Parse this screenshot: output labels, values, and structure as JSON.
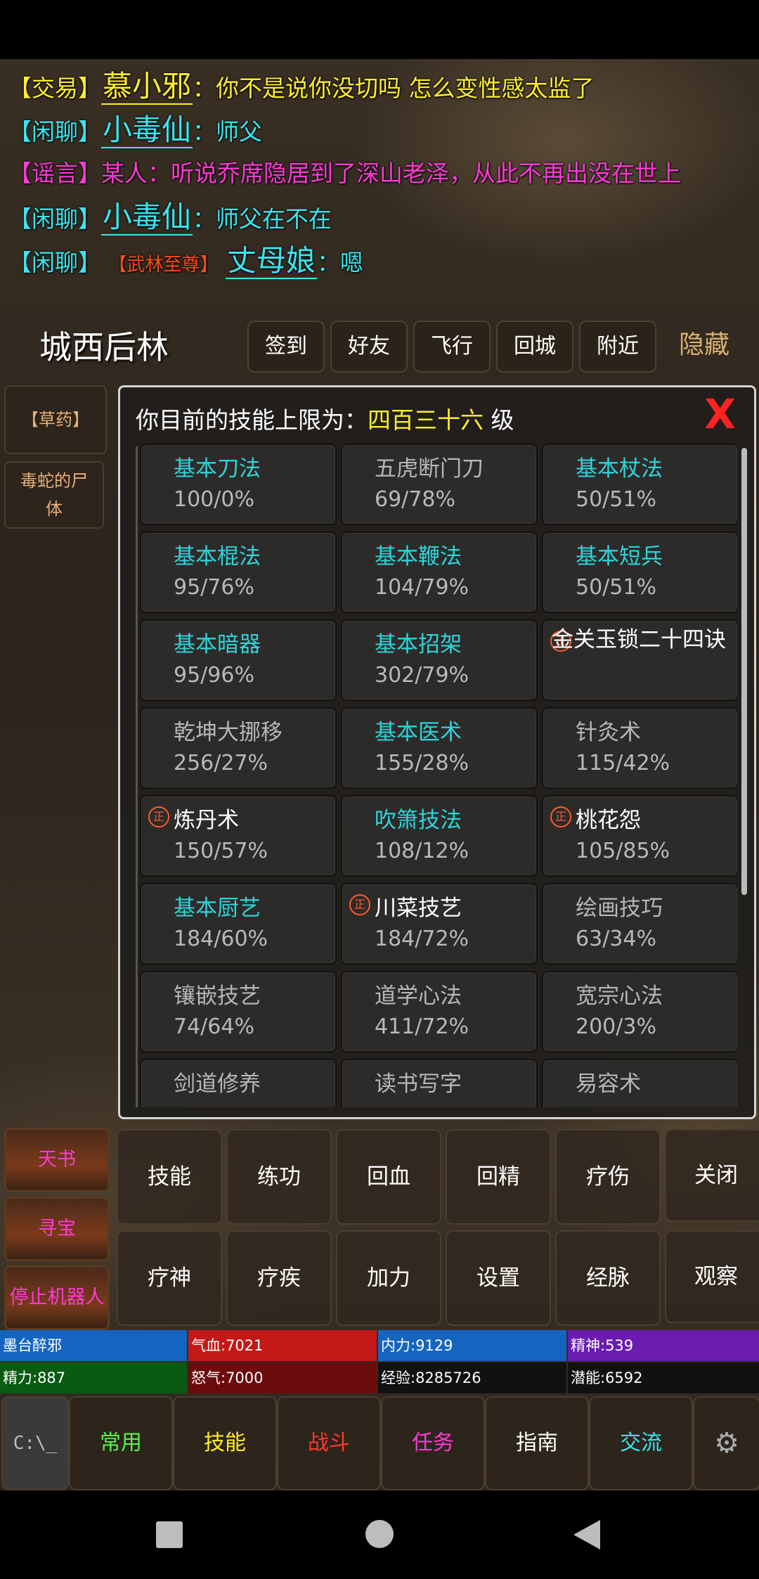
{
  "chat": [
    {
      "channel": "【交易】",
      "speaker": "慕小邪",
      "message": "：你不是说你没切吗  怎么变性感太监了",
      "type": "trade"
    },
    {
      "channel": "【闲聊】",
      "speaker": "小毒仙",
      "message": "：师父",
      "type": "chat"
    },
    {
      "channel": "【谣言】",
      "speaker": "",
      "message": "某人：听说乔席隐居到了深山老泽，从此不再出没在世上",
      "type": "rumor"
    },
    {
      "channel": "【闲聊】",
      "speaker": "小毒仙",
      "message": "：师父在不在",
      "type": "chat"
    },
    {
      "channel": "【闲聊】",
      "title": "【武林至尊】",
      "speaker": "丈母娘",
      "message": "：嗯",
      "type": "chat"
    }
  ],
  "location": "城西后林",
  "top_buttons": [
    "签到",
    "好友",
    "飞行",
    "回城",
    "附近"
  ],
  "hide_label": "隐藏",
  "side_items": [
    "【草药】",
    "毒蛇的尸体"
  ],
  "panel": {
    "title_prefix": "你目前的技能上限为：",
    "title_level": "四百三十六",
    "title_suffix": "级",
    "close": "X"
  },
  "skills": [
    {
      "name": "基本刀法",
      "level": "100/0%",
      "style": "basic"
    },
    {
      "name": "五虎断门刀",
      "level": "69/78%",
      "style": "gray"
    },
    {
      "name": "基本杖法",
      "level": "50/51%",
      "style": "basic"
    },
    {
      "name": "基本棍法",
      "level": "95/76%",
      "style": "basic"
    },
    {
      "name": "基本鞭法",
      "level": "104/79%",
      "style": "basic"
    },
    {
      "name": "基本短兵",
      "level": "50/51%",
      "style": "basic"
    },
    {
      "name": "基本暗器",
      "level": "95/96%",
      "style": "basic"
    },
    {
      "name": "基本招架",
      "level": "302/79%",
      "style": "basic"
    },
    {
      "name": "金关玉锁二十四诀",
      "level": "",
      "style": "white",
      "zheng": true,
      "wrap": true
    },
    {
      "name": "乾坤大挪移",
      "level": "256/27%",
      "style": "gray"
    },
    {
      "name": "基本医术",
      "level": "155/28%",
      "style": "basic"
    },
    {
      "name": "针灸术",
      "level": "115/42%",
      "style": "gray"
    },
    {
      "name": "炼丹术",
      "level": "150/57%",
      "style": "white",
      "zheng": true
    },
    {
      "name": "吹箫技法",
      "level": "108/12%",
      "style": "basic"
    },
    {
      "name": "桃花怨",
      "level": "105/85%",
      "style": "white",
      "zheng": true
    },
    {
      "name": "基本厨艺",
      "level": "184/60%",
      "style": "basic"
    },
    {
      "name": "川菜技艺",
      "level": "184/72%",
      "style": "white",
      "zheng": true
    },
    {
      "name": "绘画技巧",
      "level": "63/34%",
      "style": "gray"
    },
    {
      "name": "镶嵌技艺",
      "level": "74/64%",
      "style": "gray"
    },
    {
      "name": "道学心法",
      "level": "411/72%",
      "style": "gray"
    },
    {
      "name": "宽宗心法",
      "level": "200/3%",
      "style": "gray"
    },
    {
      "name": "剑道修养",
      "level": "",
      "style": "gray"
    },
    {
      "name": "读书写字",
      "level": "",
      "style": "gray"
    },
    {
      "name": "易容术",
      "level": "",
      "style": "gray"
    }
  ],
  "zheng_glyph": "正",
  "auto_buttons": [
    "天书",
    "寻宝",
    "停止机器人"
  ],
  "action_rows": [
    [
      "技能",
      "练功",
      "回血",
      "回精",
      "疗伤",
      "关闭"
    ],
    [
      "疗神",
      "疗疾",
      "加力",
      "设置",
      "经脉",
      "观察"
    ]
  ],
  "stats": {
    "row1": [
      "墨台醉邪",
      "气血:7021",
      "内力:9129",
      "精神:539"
    ],
    "row2": [
      "精力:887",
      "怒气:7000",
      "经验:8285726",
      "潜能:6592"
    ]
  },
  "tabs": [
    {
      "label": "常用",
      "color": "#5cf04a"
    },
    {
      "label": "技能",
      "color": "#ffee2a"
    },
    {
      "label": "战斗",
      "color": "#ff3a2a"
    },
    {
      "label": "任务",
      "color": "#ff3ad6"
    },
    {
      "label": "指南",
      "color": "#ffffff"
    },
    {
      "label": "交流",
      "color": "#37e6f0"
    }
  ],
  "terminal_icon_text": "C:\\_",
  "colors": {
    "trade": "#ffee2a",
    "chat": "#37e6f0",
    "rumor": "#ff3ad6",
    "basic_skill": "#2fd3d9",
    "close": "#ff2222"
  }
}
